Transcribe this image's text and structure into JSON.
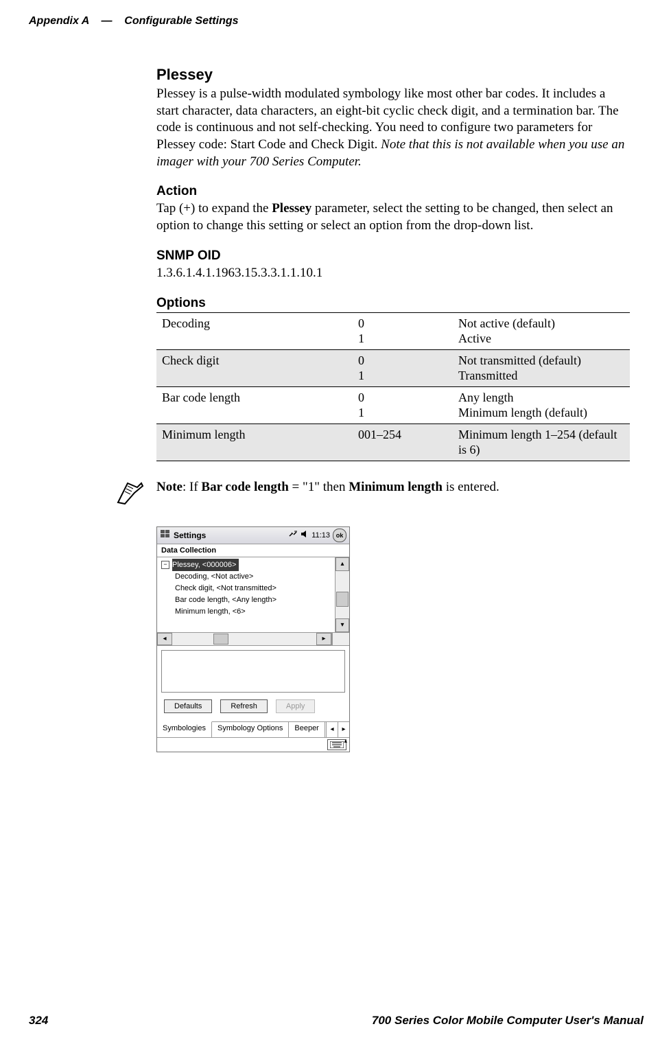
{
  "header": {
    "chapter": "Appendix  A",
    "separator": "—",
    "title": "Configurable Settings"
  },
  "sections": {
    "plessey": {
      "title": "Plessey",
      "body_a": "Plessey is a pulse-width modulated symbology like most other bar codes. It includes a start character, data characters, an eight-bit cyclic check digit, and a termination bar. The code is continuous and not self-checking. You need to configure two parameters for Plessey code: Start Code and Check Digit. ",
      "body_italic": "Note that this is not available when you use an imager with your 700 Series Computer."
    },
    "action": {
      "title": "Action",
      "body_a": "Tap (+) to expand the ",
      "body_bold1": "Plessey",
      "body_b": " parameter, select the setting to be changed, then select an option to change this setting or select an option from the drop-down list."
    },
    "snmp": {
      "title": "SNMP OID",
      "value": "1.3.6.1.4.1.1963.15.3.3.1.1.10.1"
    },
    "options": {
      "title": "Options",
      "rows": [
        {
          "name": "Decoding",
          "v0": "0",
          "v1": "1",
          "d0": "Not active (default)",
          "d1": "Active"
        },
        {
          "name": "Check digit",
          "v0": "0",
          "v1": "1",
          "d0": "Not transmitted (default)",
          "d1": "Transmitted"
        },
        {
          "name": "Bar code length",
          "v0": "0",
          "v1": "1",
          "d0": "Any length",
          "d1": "Minimum length (default)"
        },
        {
          "name": "Minimum length",
          "v0": "001–254",
          "v1": "",
          "d0": "Minimum length 1–254 (default is 6)",
          "d1": ""
        }
      ]
    },
    "note": {
      "prefix": "Note",
      "a": ": If ",
      "bold1": "Bar code length",
      "b": " = \"1\" then ",
      "bold2": "Minimum length",
      "c": " is entered."
    }
  },
  "screenshot": {
    "title": "Settings",
    "time": "11:13",
    "ok": "ok",
    "subheader": "Data Collection",
    "tree_root": "Plessey, <000006>",
    "tree_items": [
      "Decoding, <Not active>",
      "Check digit, <Not transmitted>",
      "Bar code length, <Any length>",
      "Minimum length, <6>"
    ],
    "buttons": {
      "defaults": "Defaults",
      "refresh": "Refresh",
      "apply": "Apply"
    },
    "tabs": {
      "t1": "Symbologies",
      "t2": "Symbology Options",
      "t3": "Beeper"
    }
  },
  "footer": {
    "page": "324",
    "title": "700 Series Color Mobile Computer User's Manual"
  }
}
